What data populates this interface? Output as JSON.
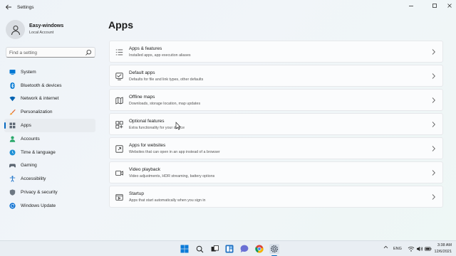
{
  "window": {
    "title": "Settings"
  },
  "profile": {
    "name": "Easy-windows",
    "account": "Local Account"
  },
  "search": {
    "placeholder": "Find a setting"
  },
  "nav": {
    "items": [
      {
        "label": "System",
        "icon": "monitor-icon",
        "active": false
      },
      {
        "label": "Bluetooth & devices",
        "icon": "bluetooth-icon",
        "active": false
      },
      {
        "label": "Network & internet",
        "icon": "wifi-icon",
        "active": false
      },
      {
        "label": "Personalization",
        "icon": "brush-icon",
        "active": false
      },
      {
        "label": "Apps",
        "icon": "apps-icon",
        "active": true
      },
      {
        "label": "Accounts",
        "icon": "person-icon",
        "active": false
      },
      {
        "label": "Time & language",
        "icon": "globe-clock-icon",
        "active": false
      },
      {
        "label": "Gaming",
        "icon": "gamepad-icon",
        "active": false
      },
      {
        "label": "Accessibility",
        "icon": "accessibility-icon",
        "active": false
      },
      {
        "label": "Privacy & security",
        "icon": "shield-icon",
        "active": false
      },
      {
        "label": "Windows Update",
        "icon": "update-icon",
        "active": false
      }
    ]
  },
  "main": {
    "title": "Apps",
    "cards": [
      {
        "title": "Apps & features",
        "desc": "Installed apps, app execution aliases",
        "icon": "list-icon"
      },
      {
        "title": "Default apps",
        "desc": "Defaults for file and link types, other defaults",
        "icon": "default-apps-icon"
      },
      {
        "title": "Offline maps",
        "desc": "Downloads, storage location, map updates",
        "icon": "map-icon"
      },
      {
        "title": "Optional features",
        "desc": "Extra functionality for your device",
        "icon": "add-grid-icon"
      },
      {
        "title": "Apps for websites",
        "desc": "Websites that can open in an app instead of a browser",
        "icon": "open-link-icon"
      },
      {
        "title": "Video playback",
        "desc": "Video adjustments, HDR streaming, battery options",
        "icon": "video-icon"
      },
      {
        "title": "Startup",
        "desc": "Apps that start automatically when you sign in",
        "icon": "startup-icon"
      }
    ]
  },
  "taskbar": {
    "lang": "ENG",
    "time": "3:38 AM",
    "date": "12/6/2021"
  },
  "colors": {
    "accent": "#0067c0"
  }
}
